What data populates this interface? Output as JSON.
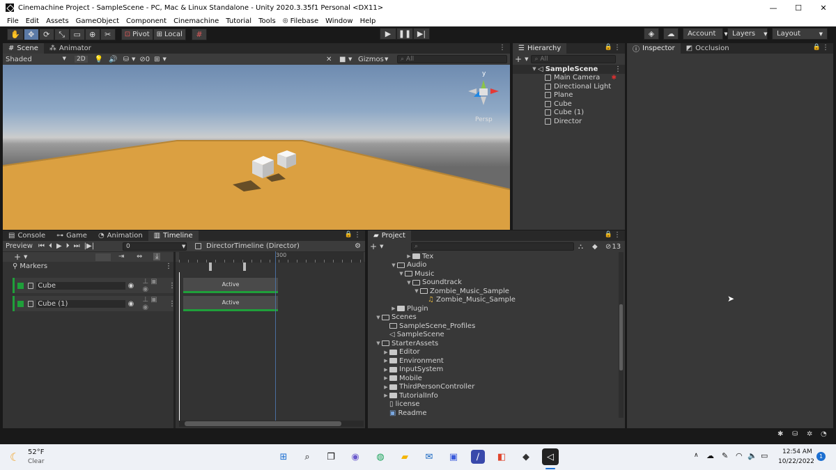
{
  "window": {
    "title": "Cinemachine Project - SampleScene - PC, Mac & Linux Standalone - Unity 2020.3.35f1 Personal <DX11>",
    "minimize": "—",
    "maximize": "☐",
    "close": "✕"
  },
  "menu": [
    "File",
    "Edit",
    "Assets",
    "GameObject",
    "Component",
    "Cinemachine",
    "Tutorial",
    "Tools",
    "Filebase",
    "Window",
    "Help"
  ],
  "toolbar": {
    "pivot": "Pivot",
    "local": "Local",
    "account": "Account",
    "layers": "Layers",
    "layout": "Layout"
  },
  "scene_panel": {
    "tabs": [
      "Scene",
      "Animator"
    ],
    "shading": "Shaded",
    "mode_2d": "2D",
    "fx_count": "0",
    "gizmos": "Gizmos",
    "search_placeholder": "All",
    "persp_label": "Persp",
    "gizmo_axis_y": "y"
  },
  "hierarchy": {
    "tab": "Hierarchy",
    "search_placeholder": "All",
    "scene": "SampleScene",
    "items": [
      "Main Camera",
      "Directional Light",
      "Plane",
      "Cube",
      "Cube (1)",
      "Director"
    ]
  },
  "inspector": {
    "tabs": [
      "Inspector",
      "Occlusion"
    ]
  },
  "bottom_left": {
    "tabs": [
      "Console",
      "Game",
      "Animation",
      "Timeline"
    ],
    "preview": "Preview",
    "frame": "0",
    "director": "DirectorTimeline (Director)",
    "markers": "Markers",
    "ruler_label": "300",
    "tracks": [
      {
        "name": "Cube",
        "clip": "Active"
      },
      {
        "name": "Cube (1)",
        "clip": "Active"
      }
    ]
  },
  "project": {
    "tab": "Project",
    "hidden_count": "13",
    "tree": [
      {
        "label": "Tex",
        "indent": 4,
        "kind": "folder",
        "arrow": "▶"
      },
      {
        "label": "Audio",
        "indent": 2,
        "kind": "folder-open",
        "arrow": "▼"
      },
      {
        "label": "Music",
        "indent": 3,
        "kind": "folder-open",
        "arrow": "▼"
      },
      {
        "label": "Soundtrack",
        "indent": 4,
        "kind": "folder-open",
        "arrow": "▼"
      },
      {
        "label": "Zombie_Music_Sample",
        "indent": 5,
        "kind": "folder-open",
        "arrow": "▼"
      },
      {
        "label": "Zombie_Music_Sample",
        "indent": 6,
        "kind": "audio",
        "arrow": ""
      },
      {
        "label": "Plugin",
        "indent": 2,
        "kind": "folder",
        "arrow": "▶"
      },
      {
        "label": "Scenes",
        "indent": 0,
        "kind": "folder-open",
        "arrow": "▼"
      },
      {
        "label": "SampleScene_Profiles",
        "indent": 1,
        "kind": "folder-open",
        "arrow": ""
      },
      {
        "label": "SampleScene",
        "indent": 1,
        "kind": "scene",
        "arrow": ""
      },
      {
        "label": "StarterAssets",
        "indent": 0,
        "kind": "folder-open",
        "arrow": "▼"
      },
      {
        "label": "Editor",
        "indent": 1,
        "kind": "folder",
        "arrow": "▶"
      },
      {
        "label": "Environment",
        "indent": 1,
        "kind": "folder",
        "arrow": "▶"
      },
      {
        "label": "InputSystem",
        "indent": 1,
        "kind": "folder",
        "arrow": "▶"
      },
      {
        "label": "Mobile",
        "indent": 1,
        "kind": "folder",
        "arrow": "▶"
      },
      {
        "label": "ThirdPersonController",
        "indent": 1,
        "kind": "folder",
        "arrow": "▶"
      },
      {
        "label": "TutorialInfo",
        "indent": 1,
        "kind": "folder",
        "arrow": "▶"
      },
      {
        "label": "license",
        "indent": 1,
        "kind": "file",
        "arrow": ""
      },
      {
        "label": "Readme",
        "indent": 1,
        "kind": "readme",
        "arrow": ""
      }
    ]
  },
  "taskbar": {
    "temperature": "52°F",
    "weather": "Clear",
    "time": "12:54 AM",
    "date": "10/22/2022",
    "notification_count": "1"
  },
  "colors": {
    "accent": "#5b7aa6",
    "clip_bar": "#1f9f3a",
    "ground": "#dba041"
  }
}
